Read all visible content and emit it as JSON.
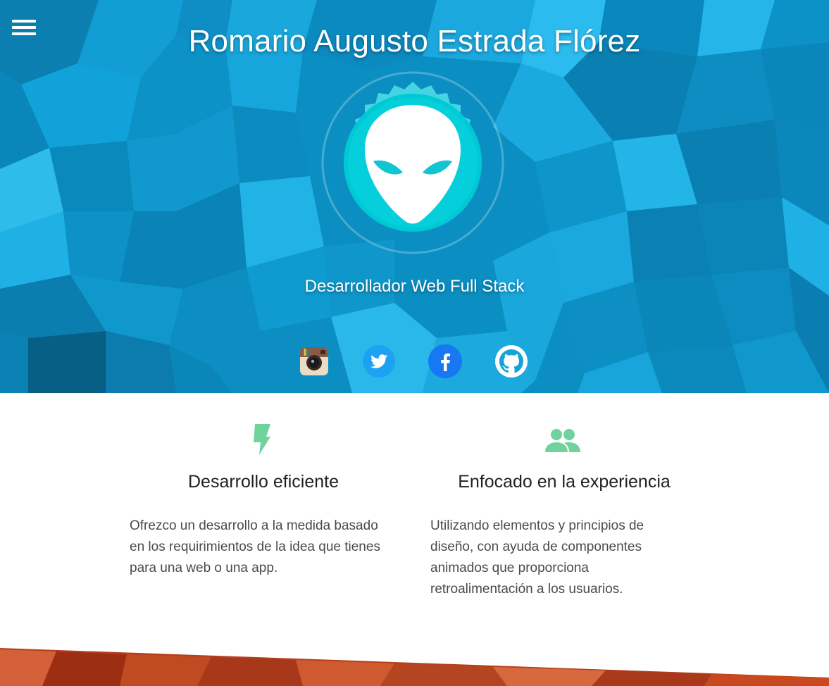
{
  "header": {
    "title": "Romario Augusto Estrada Flórez",
    "subtitle": "Desarrollador Web Full Stack",
    "menu_icon": "hamburger-menu-icon",
    "avatar_icon": "alien-head-icon"
  },
  "social": [
    {
      "name": "instagram",
      "icon": "instagram-icon",
      "color": "#8a5a44"
    },
    {
      "name": "twitter",
      "icon": "twitter-icon",
      "color": "#1da1f2"
    },
    {
      "name": "facebook",
      "icon": "facebook-icon",
      "color": "#1877f2"
    },
    {
      "name": "github",
      "icon": "github-icon",
      "color": "#ffffff"
    }
  ],
  "features": [
    {
      "icon": "lightning-bolt-icon",
      "title": "Desarrollo eficiente",
      "text": "Ofrezco un desarrollo a la medida basado en los requirimientos de la idea que tienes para una web o una app."
    },
    {
      "icon": "people-group-icon",
      "title": "Enfocado en la experiencia",
      "text": "Utilizando elementos y principios de diseño, con ayuda de componentes animados que proporciona retroalimentación a los usuarios."
    }
  ],
  "colors": {
    "hero_blue": "#0b8fc2",
    "accent_teal": "#00c9d6",
    "feature_icon_green": "#6fd39b",
    "footer_orange": "#c8481f"
  }
}
